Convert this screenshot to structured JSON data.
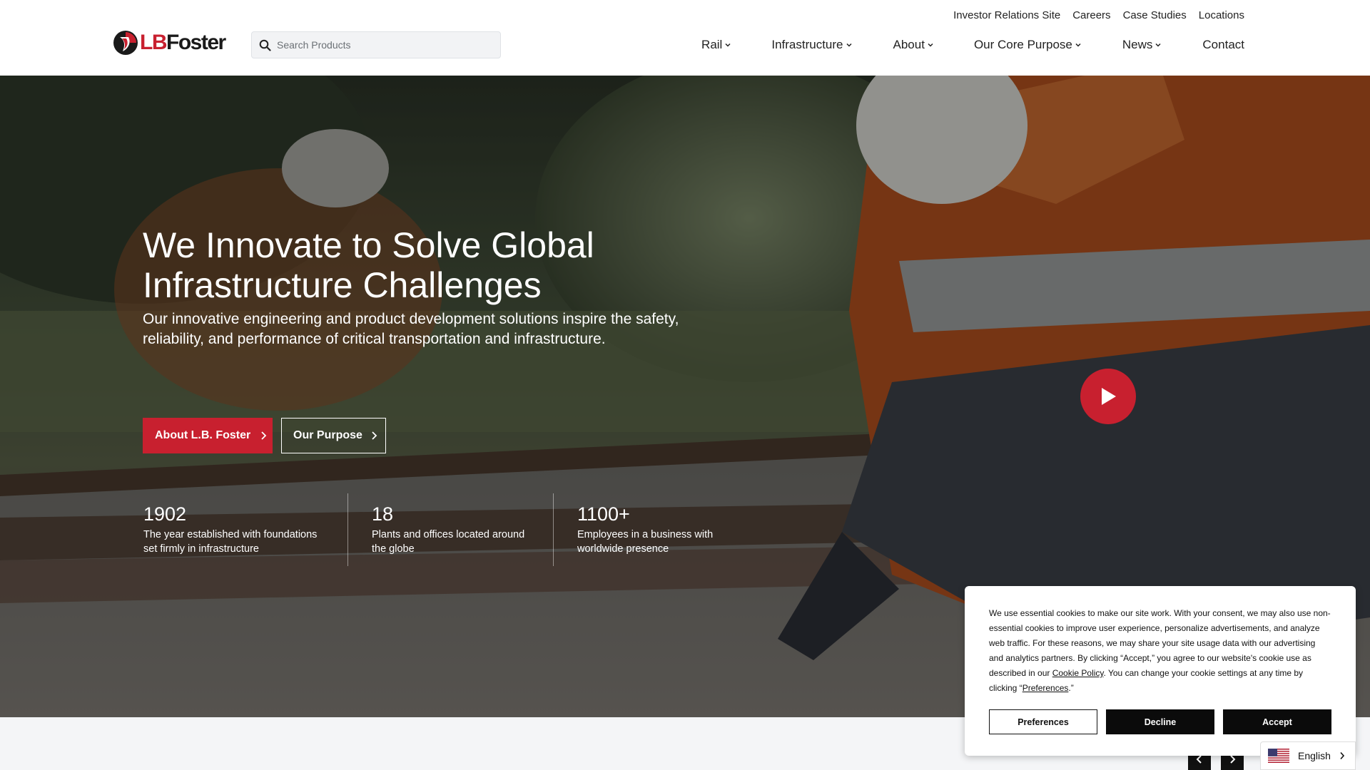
{
  "utility_nav": [
    "Investor Relations Site",
    "Careers",
    "Case Studies",
    "Locations"
  ],
  "logo": {
    "text_lb": "LB",
    "text_foster": "Foster",
    "icon": "lbfoster-logo-icon"
  },
  "search": {
    "placeholder": "Search Products",
    "icon": "search-icon"
  },
  "main_nav": [
    {
      "label": "Rail",
      "has_dropdown": true
    },
    {
      "label": "Infrastructure",
      "has_dropdown": true
    },
    {
      "label": "About",
      "has_dropdown": true
    },
    {
      "label": "Our Core Purpose",
      "has_dropdown": true
    },
    {
      "label": "News",
      "has_dropdown": true
    },
    {
      "label": "Contact",
      "has_dropdown": false
    }
  ],
  "hero": {
    "title": "We Innovate to Solve Global Infrastructure Challenges",
    "subtitle": "Our innovative engineering and product development solutions inspire the safety, reliability, and performance of critical transportation and infrastructure.",
    "primary_button": "About L.B. Foster",
    "secondary_button": "Our Purpose",
    "stats": [
      {
        "number": "1902",
        "desc": "The year established with foundations set firmly in infrastructure"
      },
      {
        "number": "18",
        "desc": "Plants and offices located around the globe"
      },
      {
        "number": "1100+",
        "desc": "Employees in a business with worldwide presence"
      }
    ],
    "play_icon": "play-icon"
  },
  "cookie": {
    "text_1": "We use essential cookies to make our site work. With your consent, we may also use non-essential cookies to improve user experience, personalize advertisements, and analyze web traffic. For these reasons, we may share your site usage data with our advertising and analytics partners. By clicking “Accept,” you agree to our website's cookie use as described in our ",
    "link_policy": "Cookie Policy",
    "text_2": ". You can change your cookie settings at any time by clicking “",
    "link_prefs": "Preferences",
    "text_3": ".”",
    "buttons": {
      "preferences": "Preferences",
      "decline": "Decline",
      "accept": "Accept"
    }
  },
  "language": {
    "label": "English",
    "flag_icon": "us-flag-icon"
  },
  "colors": {
    "brand_red": "#c8202f",
    "dark": "#0b0b0b"
  }
}
